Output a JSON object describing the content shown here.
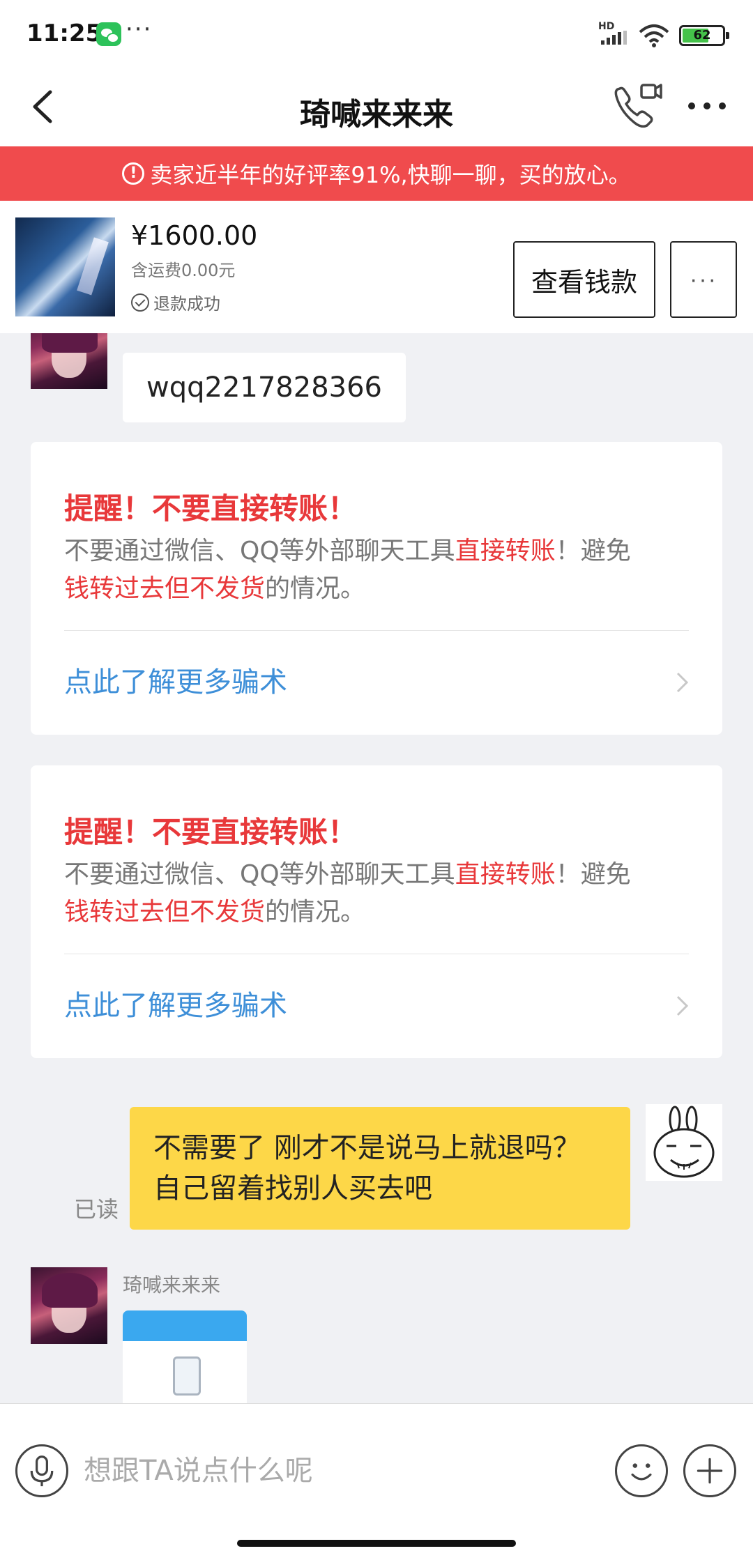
{
  "status_bar": {
    "time": "11:25",
    "more": "···",
    "network": "HD",
    "battery": "62",
    "battery_fraction": 0.62
  },
  "header": {
    "title": "琦喊来来来"
  },
  "banner": {
    "text": "卖家近半年的好评率91%,快聊一聊，买的放心。",
    "icon": "!"
  },
  "product": {
    "price": "¥1600.00",
    "shipping": "含运费0.00元",
    "status": "退款成功",
    "view_button": "查看钱款",
    "more_button": "···"
  },
  "messages": {
    "first_text": "wqq2217828366",
    "warnings": [
      {
        "title": "提醒！不要直接转账！",
        "body_1": "不要通过微信、QQ等外部聊天工具",
        "body_red_1": "直接转账",
        "body_2": "！避免",
        "body_red_2": "钱转过去但不发货",
        "body_3": "的情况。",
        "link": "点此了解更多骗术"
      },
      {
        "title": "提醒！不要直接转账！",
        "body_1": "不要通过微信、QQ等外部聊天工具",
        "body_red_1": "直接转账",
        "body_2": "！避免",
        "body_red_2": "钱转过去但不发货",
        "body_3": "的情况。",
        "link": "点此了解更多骗术"
      }
    ],
    "my_reply": "不需要了 刚才不是说马上就退吗？自己留着找别人买去吧",
    "read_label": "已读",
    "sender_name": "琦喊来来来"
  },
  "input": {
    "placeholder": "想跟TA说点什么呢"
  },
  "colors": {
    "banner": "#f04b4d",
    "alert_red": "#e8383a",
    "link_blue": "#3e8fd8",
    "my_bubble": "#fdd748"
  },
  "icons": [
    "back-icon",
    "phone-video-icon",
    "more-icon",
    "alert-icon",
    "check-circle-icon",
    "chevron-right-icon",
    "mic-icon",
    "emoji-icon",
    "plus-icon"
  ]
}
